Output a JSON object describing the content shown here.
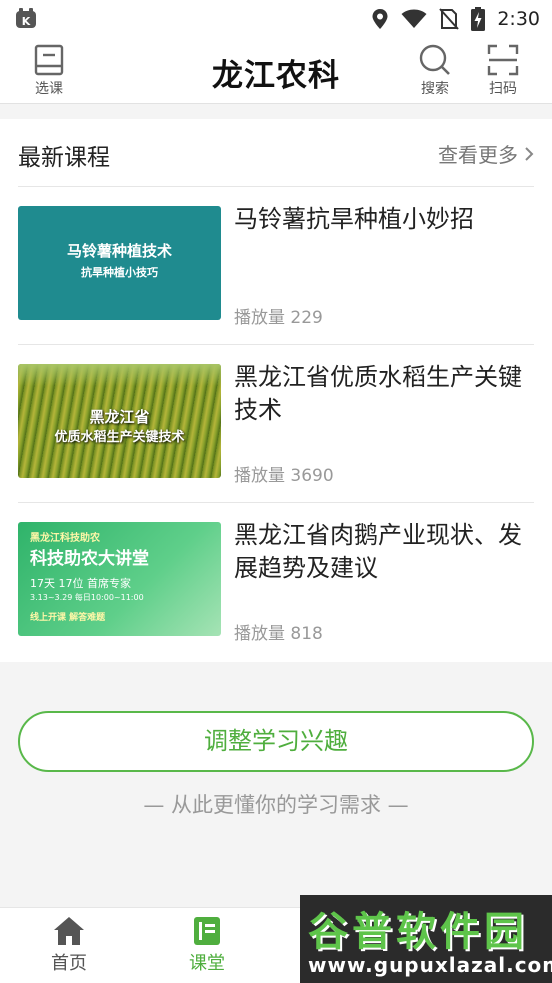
{
  "status_bar": {
    "time": "2:30"
  },
  "header": {
    "title": "龙江农科",
    "left_button": {
      "label": "选课",
      "icon": "book-icon"
    },
    "search_button": {
      "label": "搜索",
      "icon": "search-icon"
    },
    "scan_button": {
      "label": "扫码",
      "icon": "scan-icon"
    }
  },
  "latest": {
    "title": "最新课程",
    "more": "查看更多",
    "courses": [
      {
        "title": "马铃薯抗旱种植小妙招",
        "plays": "播放量 229",
        "thumb_line1": "马铃薯种植技术",
        "thumb_line2": "抗旱种植小技巧"
      },
      {
        "title": "黑龙江省优质水稻生产关键技术",
        "plays": "播放量 3690",
        "thumb_line1": "黑龙江省",
        "thumb_line2": "优质水稻生产关键技术"
      },
      {
        "title": "黑龙江省肉鹅产业现状、发展趋势及建议",
        "plays": "播放量 818",
        "thumb_line1": "黑龙江科技助农",
        "thumb_line2": "科技助农大讲堂",
        "thumb_line3": "17天 17位 首席专家",
        "thumb_line4": "3.13~3.29 每日10:00~11:00",
        "thumb_line5": "线上开课  解答难题"
      }
    ]
  },
  "interest": {
    "button": "调整学习兴趣",
    "subtitle": "— 从此更懂你的学习需求 —"
  },
  "bottom_nav": [
    {
      "label": "首页",
      "icon": "home-icon"
    },
    {
      "label": "课堂",
      "icon": "classroom-icon",
      "active": true
    }
  ],
  "watermark": {
    "text": "谷普软件园",
    "url": "www.gupuxlazal.com"
  },
  "colors": {
    "accent": "#4fae3e",
    "teal_thumb": "#1f8b8f"
  }
}
